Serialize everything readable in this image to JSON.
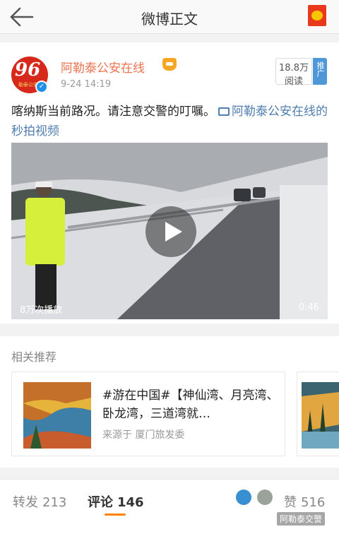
{
  "header": {
    "title": "微博正文"
  },
  "post": {
    "username": "阿勒泰公安在线",
    "avatar_text": "96",
    "avatar_subtext": "勒泰公安",
    "time": "9-24 14:19",
    "reads": {
      "count": "18.8万",
      "label": "阅读"
    },
    "promote": "推广",
    "text": "喀纳斯当前路况。请注意交警的叮嘱。",
    "video_link": "阿勒泰公安在线的秒拍视频",
    "video": {
      "plays": "8万次播放",
      "duration": "0:46"
    }
  },
  "recommend": {
    "title": "相关推荐",
    "card": {
      "text": "#游在中国#【神仙湾、月亮湾、卧龙湾，三道湾就…",
      "source": "来源于  厦门旅发委"
    }
  },
  "bottom": {
    "repost": {
      "label": "转发",
      "count": "213"
    },
    "comment": {
      "label": "评论",
      "count": "146"
    },
    "like": {
      "label": "赞",
      "count": "516"
    },
    "watermark": "阿勒泰交警"
  },
  "colors": {
    "accent": "#ff8200",
    "username": "#eb7350",
    "link": "#507daf"
  }
}
